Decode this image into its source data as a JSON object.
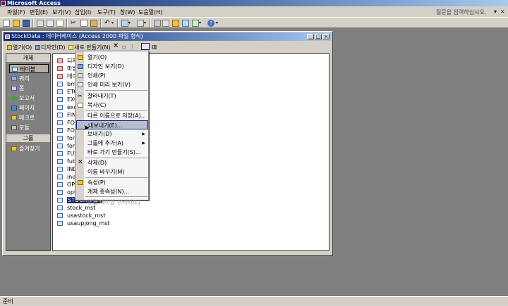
{
  "app": {
    "title": "Microsoft Access"
  },
  "menubar": {
    "items": [
      "파일(F)",
      "편집(E)",
      "보기(V)",
      "삽입(I)",
      "도구(T)",
      "창(W)",
      "도움말(H)"
    ],
    "ask_placeholder": "질문을 입력하십시오."
  },
  "dbwindow": {
    "title": "StockData : 데이터베이스 (Access 2000 파일 형식)",
    "toolbar": {
      "open": "열기(O)",
      "design": "디자인(D)",
      "new": "새로 만들기(N)"
    },
    "objects_header": "개체",
    "objects": [
      "테이블",
      "쿼리",
      "폼",
      "보고서",
      "페이지",
      "매크로",
      "모듈"
    ],
    "groups_header": "그룹",
    "groups": [
      "즐겨찾기"
    ],
    "tables": [
      "디자",
      "마법",
      "데이",
      "bmi",
      "ETC",
      "EXO",
      "exc",
      "FINA",
      "FOR",
      "FOR",
      "fore",
      "fore",
      "FUT",
      "futu",
      "INDI",
      "indu",
      "OPT",
      "optio",
      "STOCK_MST",
      "stock_mst",
      "usastock_mst",
      "usaupjong_mst"
    ],
    "selected_table": "STOCK_MST"
  },
  "context_menu": {
    "items": [
      {
        "label": "열기(O)",
        "icon": "open-icon"
      },
      {
        "label": "디자인 보기(D)",
        "icon": "design-icon"
      },
      {
        "label": "인쇄(P)",
        "icon": "print-icon"
      },
      {
        "label": "인쇄 미리 보기(V)",
        "icon": "preview-icon"
      },
      {
        "label": "잘라내기(T)",
        "icon": "cut-icon"
      },
      {
        "label": "복사(C)",
        "icon": "copy-icon"
      },
      {
        "label": "다른 이름으로 저장(A)...",
        "icon": ""
      },
      {
        "label": "내보내기(E)...",
        "icon": "",
        "highlighted": true
      },
      {
        "label": "보내기(D)",
        "icon": "",
        "submenu": true
      },
      {
        "label": "그룹에 추가(A)",
        "icon": "",
        "submenu": true
      },
      {
        "label": "바로 가기 만들기(S)...",
        "icon": ""
      },
      {
        "label": "삭제(D)",
        "icon": "delete-icon"
      },
      {
        "label": "이름 바꾸기(M)",
        "icon": ""
      },
      {
        "label": "속성(P)",
        "icon": "properties-icon"
      },
      {
        "label": "개체 종속성(N)...",
        "icon": ""
      },
      {
        "label": "연결 테이블 관리자(L)",
        "icon": "",
        "disabled": true
      }
    ]
  },
  "status": {
    "text": "준비"
  }
}
